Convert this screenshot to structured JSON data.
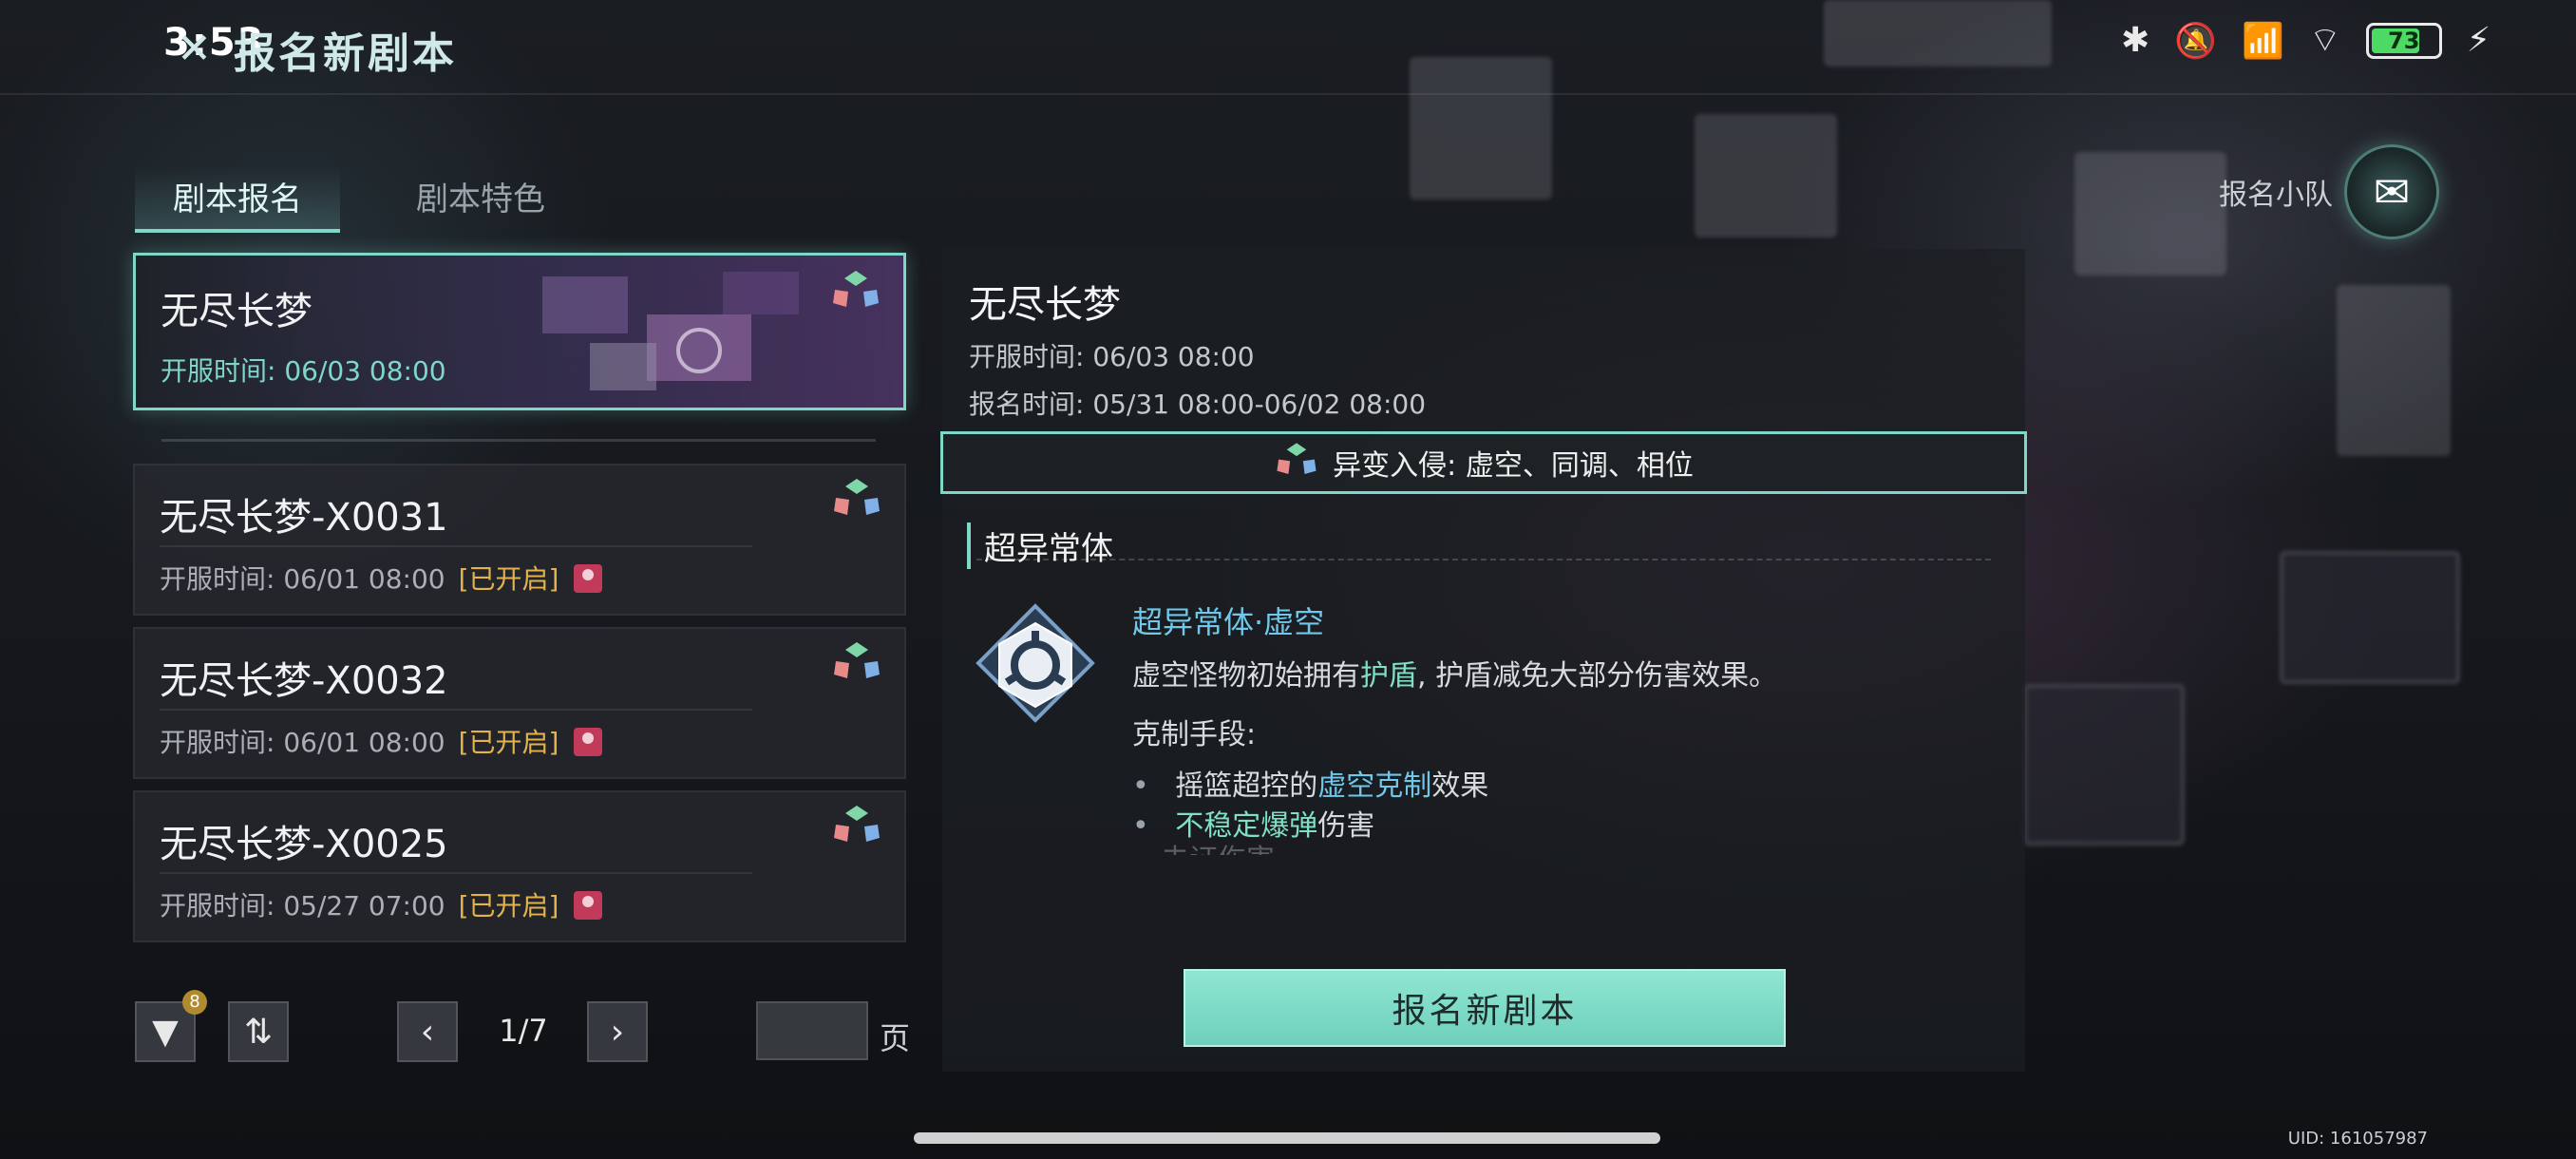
{
  "status_bar": {
    "time": "3:53",
    "battery": "73"
  },
  "header": {
    "title": "报名新剧本"
  },
  "tabs": [
    {
      "label": "剧本报名",
      "active": true
    },
    {
      "label": "剧本特色",
      "active": false
    }
  ],
  "team": {
    "label": "报名小队"
  },
  "list": {
    "selected": {
      "name": "无尽长梦",
      "open_time": "开服时间: 06/03 08:00"
    },
    "items": [
      {
        "name": "无尽长梦-X0031",
        "open_time": "开服时间: 06/01 08:00",
        "status": "[已开启]"
      },
      {
        "name": "无尽长梦-X0032",
        "open_time": "开服时间: 06/01 08:00",
        "status": "[已开启]"
      },
      {
        "name": "无尽长梦-X0025",
        "open_time": "开服时间: 05/27 07:00",
        "status": "[已开启]"
      }
    ]
  },
  "controls": {
    "filter_badge": "8",
    "page": "1/7",
    "page_suffix": "页"
  },
  "detail": {
    "title": "无尽长梦",
    "open_time": "开服时间: 06/03 08:00",
    "signup_time": "报名时间: 05/31 08:00-06/02 08:00",
    "mutation": "异变入侵: 虚空、同调、相位",
    "section_title": "超异常体",
    "ability": {
      "name": "超异常体·虚空",
      "desc_pre": "虚空怪物初始拥有",
      "desc_hl": "护盾",
      "desc_post": ", 护盾减免大部分伤害效果。",
      "counter_title": "克制手段:",
      "counter1_pre": "摇篮超控的",
      "counter1_hl": "虚空克制",
      "counter1_post": "效果",
      "counter2_hl": "不稳定爆弹",
      "counter2_post": "伤害",
      "counter3_faded": "未证伤害"
    },
    "button": "报名新剧本"
  },
  "footer": {
    "uid": "UID: 161057987"
  },
  "colors": {
    "accent": "#7fd7c8",
    "status_open": "#e3b24a",
    "ability_name": "#6fc8ea"
  }
}
